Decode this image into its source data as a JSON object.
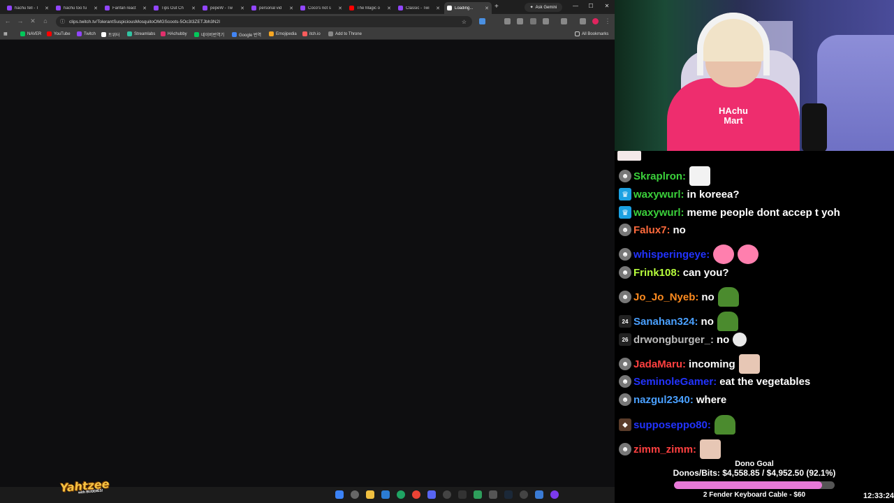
{
  "browser": {
    "tabs": [
      {
        "label": "hachu fell - T",
        "color": "#9146ff"
      },
      {
        "label": "hachu too fu",
        "color": "#9146ff"
      },
      {
        "label": "Fanfan react",
        "color": "#9146ff"
      },
      {
        "label": "Tips Out Ch",
        "color": "#9146ff"
      },
      {
        "label": "pepeW - Tw",
        "color": "#9146ff"
      },
      {
        "label": "personal vid",
        "color": "#9146ff"
      },
      {
        "label": "Coco's not s",
        "color": "#9146ff"
      },
      {
        "label": "The Magic o",
        "color": "#ff0000"
      },
      {
        "label": "Classic - Twi",
        "color": "#9146ff"
      },
      {
        "label": "Loading...",
        "color": "#ffffff"
      }
    ],
    "new_tab": "+",
    "ask_gemini": "Ask Gemini",
    "url": "clips.twitch.tv/TolerantSuspiciousMosquitoOMGScoots-5Oc3I3ZETJbh3N2I",
    "bookmarks": [
      {
        "label": "NAVER",
        "color": "#03c75a"
      },
      {
        "label": "YouTube",
        "color": "#ff0000"
      },
      {
        "label": "Twitch",
        "color": "#9146ff"
      },
      {
        "label": "트위터",
        "color": "#ffffff"
      },
      {
        "label": "Streamlabs",
        "color": "#31c3a2"
      },
      {
        "label": "HAchubby",
        "color": "#e1306c"
      },
      {
        "label": "네이버번역기",
        "color": "#03c75a"
      },
      {
        "label": "Google 번역",
        "color": "#4285f4"
      },
      {
        "label": "Emojipedia",
        "color": "#f5a623"
      },
      {
        "label": "itch.io",
        "color": "#fa5c5c"
      },
      {
        "label": "Add to Throne",
        "color": "#888888"
      }
    ],
    "all_bookmarks": "All Bookmarks"
  },
  "overlay": {
    "yahtzee": "Yahtzee",
    "yahtzee_sub": "with BUDDIES!",
    "shirt_logo": "HAchu Mart"
  },
  "chat": {
    "messages": [
      {
        "user": "Skraplron:",
        "color": "#3bd13b",
        "badge": "mod",
        "text": "",
        "emotes": [
          "cat"
        ]
      },
      {
        "user": "waxywurl:",
        "color": "#3bd13b",
        "badge": "crown",
        "text": "in koreea?",
        "emotes": []
      },
      {
        "user": "waxywurl:",
        "color": "#3bd13b",
        "badge": "crown",
        "text": "meme people dont accep t yoh",
        "emotes": []
      },
      {
        "user": "Falux7:",
        "color": "#ff6a3c",
        "badge": "mod",
        "text": "no",
        "emotes": []
      },
      {
        "user": "whisperingeye:",
        "color": "#2233ff",
        "badge": "mod",
        "text": "",
        "emotes": [
          "pink",
          "pink"
        ]
      },
      {
        "user": "Frink108:",
        "color": "#b7ff3c",
        "badge": "mod",
        "text": "can you?",
        "emotes": []
      },
      {
        "user": "Jo_Jo_Nyeb:",
        "color": "#ff8b1f",
        "badge": "mod",
        "text": "no",
        "emotes": [
          "pepe"
        ]
      },
      {
        "user": "Sanahan324:",
        "color": "#4aa0ff",
        "badge": "num",
        "badge_text": "24",
        "text": "no",
        "emotes": [
          "pepe"
        ]
      },
      {
        "user": "drwongburger_:",
        "color": "#bbbbbb",
        "badge": "num",
        "badge_text": "26",
        "text": "no",
        "emotes": [
          "ghost"
        ]
      },
      {
        "user": "JadaMaru:",
        "color": "#ff4040",
        "badge": "mod",
        "text": "incoming",
        "emotes": [
          "face"
        ]
      },
      {
        "user": "SeminoleGamer:",
        "color": "#2233ff",
        "badge": "mod",
        "text": "eat the vegetables",
        "emotes": []
      },
      {
        "user": "nazgul2340:",
        "color": "#4aa0ff",
        "badge": "mod",
        "text": "where",
        "emotes": []
      },
      {
        "user": "supposeppo80:",
        "color": "#2233ff",
        "badge": "sub",
        "text": "",
        "emotes": [
          "pepe"
        ]
      },
      {
        "user": "zimm_zimm:",
        "color": "#ff4040",
        "badge": "mod",
        "text": "",
        "emotes": [
          "face"
        ]
      }
    ]
  },
  "dono": {
    "title": "Dono Goal",
    "amount": "Donos/Bits: $4,558.85 / $4,952.50 (92.1%)",
    "progress": 0.921,
    "item": "2 Fender Keyboard Cable - $60"
  },
  "clock": "12:33:24"
}
